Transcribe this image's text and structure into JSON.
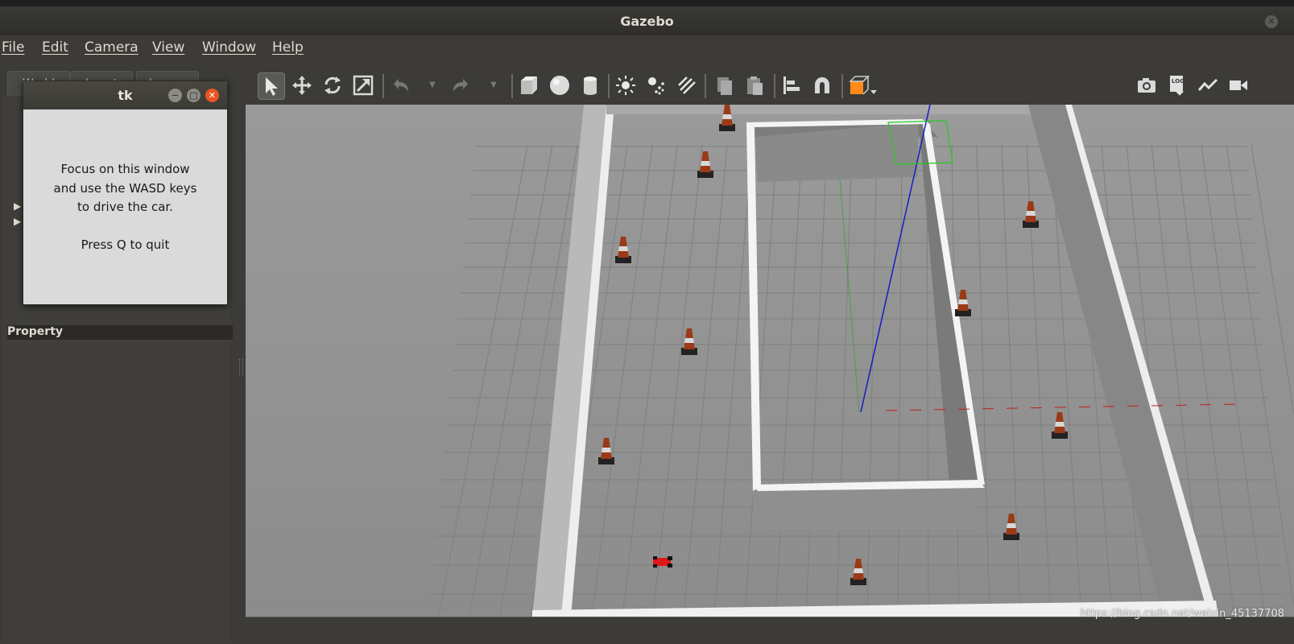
{
  "window": {
    "title": "Gazebo",
    "close_symbol": "✕"
  },
  "menu": [
    "File",
    "Edit",
    "Camera",
    "View",
    "Window",
    "Help"
  ],
  "left_panel": {
    "tabs": [
      "World",
      "Insert",
      "Layers"
    ],
    "properties_label": "Property"
  },
  "toolbar": {
    "tools": [
      "select-arrow-icon",
      "translate-icon",
      "rotate-icon",
      "scale-icon",
      "undo-icon",
      "undo-dropdown-icon",
      "redo-icon",
      "redo-dropdown-icon",
      "box-icon",
      "sphere-icon",
      "cylinder-icon",
      "point-light-icon",
      "spot-light-icon",
      "directional-light-icon",
      "copy-icon",
      "paste-icon",
      "align-icon",
      "magnet-icon",
      "view-angle-icon"
    ],
    "right_tools": [
      "screenshot-icon",
      "log-icon",
      "plot-icon",
      "video-record-icon"
    ]
  },
  "tk_window": {
    "title": "tk",
    "lines": [
      "Focus on this window",
      "and use the WASD keys",
      "to drive the car.",
      "",
      "Press Q to quit"
    ]
  },
  "watermark": "https://blog.csdn.net/weixin_45137708",
  "colors": {
    "accent": "#e95420",
    "axis_x": "#c02020",
    "axis_y": "#20a020",
    "axis_z": "#1a1acc",
    "car": "#e01818",
    "selection": "#22cc22"
  }
}
